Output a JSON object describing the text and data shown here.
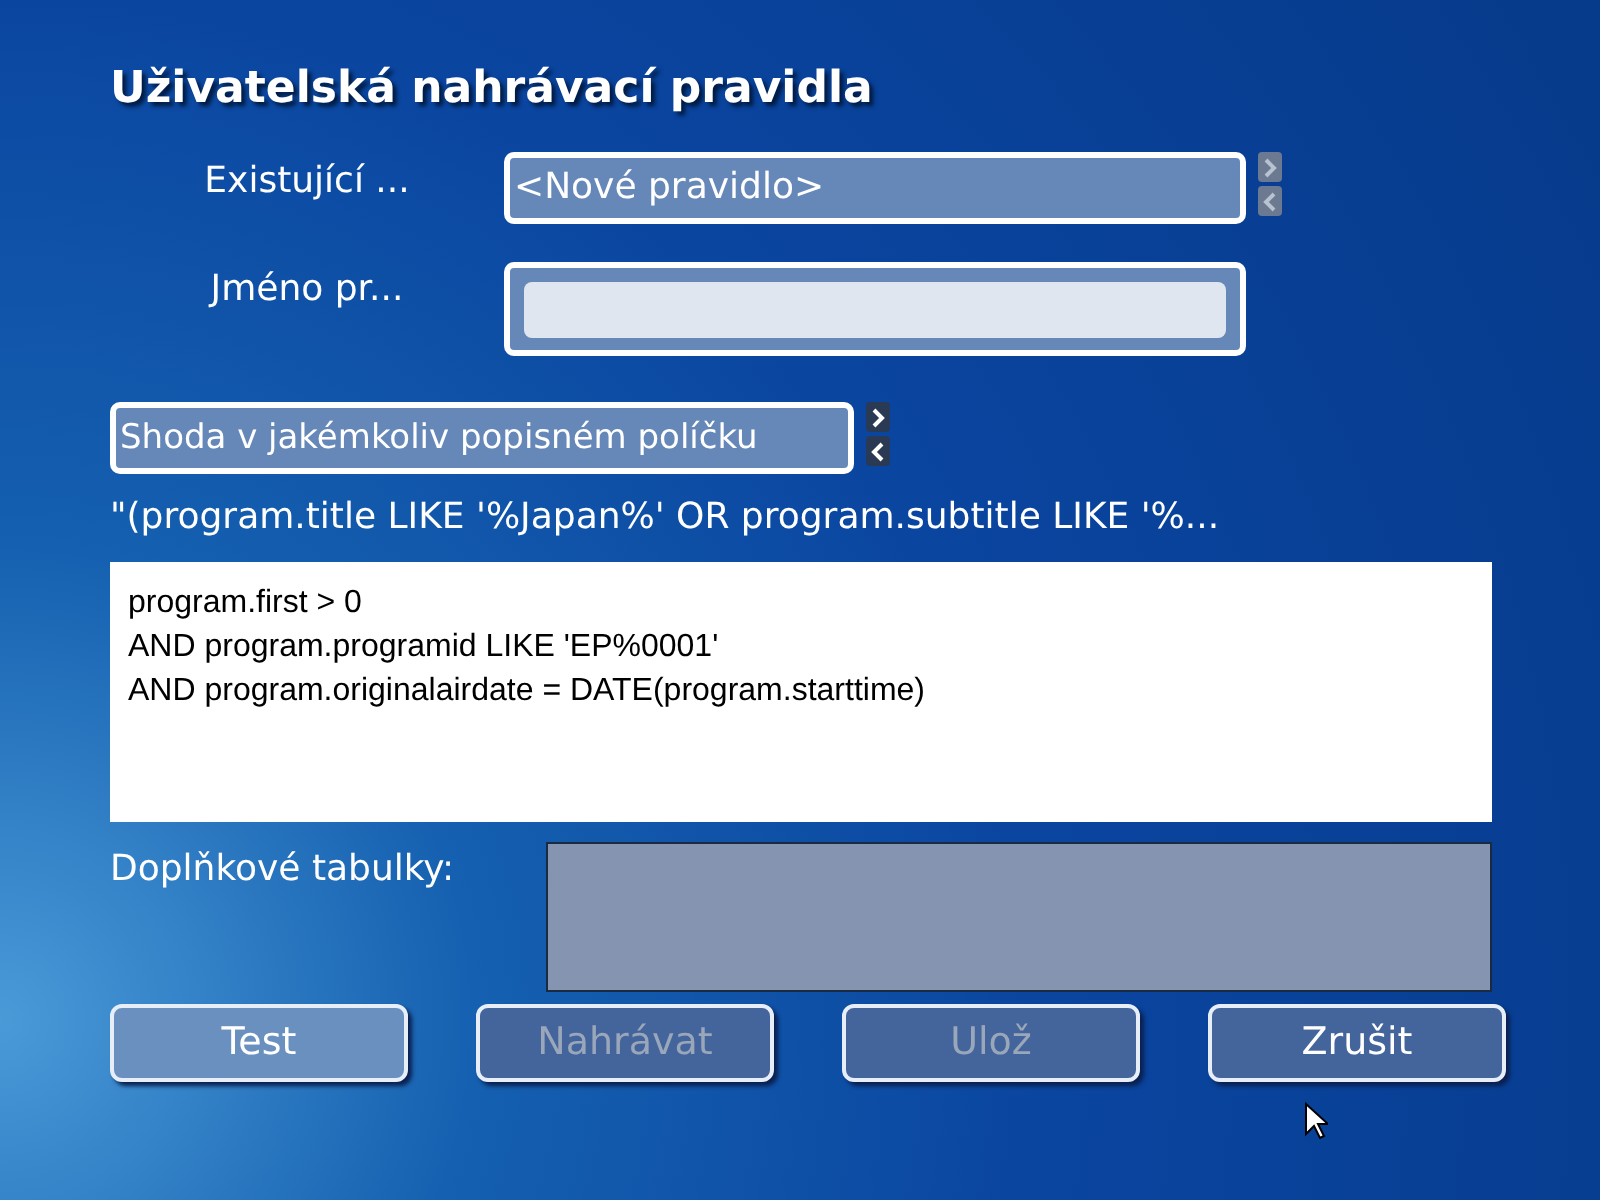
{
  "title": "Uživatelská nahrávací pravidla",
  "rule_selector": {
    "label": "Existující ...",
    "value": "<Nové pravidlo>"
  },
  "name_field": {
    "label": "Jméno pr..."
  },
  "match_selector": {
    "value": "Shoda v jakémkoliv popisném políčku"
  },
  "query_preview": "\"(program.title LIKE '%Japan%' OR program.subtitle LIKE '%...",
  "sql_editor": {
    "lines": [
      "program.first > 0",
      "AND program.programid LIKE 'EP%0001'",
      "AND program.originalairdate = DATE(program.starttime)"
    ]
  },
  "additional_tables": {
    "label": "Doplňkové tabulky:"
  },
  "buttons": [
    {
      "label": "Test",
      "disabled": false,
      "selected": true
    },
    {
      "label": "Nahrávat",
      "disabled": true,
      "selected": false
    },
    {
      "label": "Ulož",
      "disabled": true,
      "selected": false
    },
    {
      "label": "Zrušit",
      "disabled": false,
      "selected": false
    }
  ]
}
